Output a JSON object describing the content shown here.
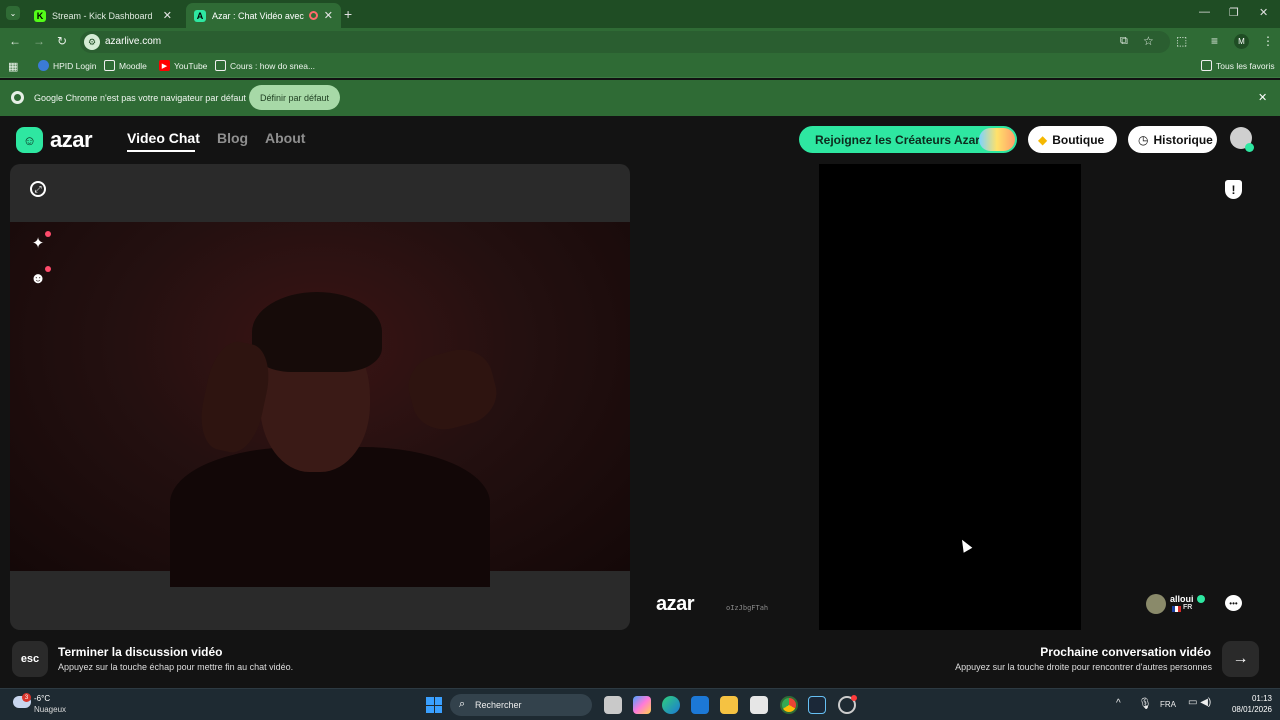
{
  "browser": {
    "tabs": [
      {
        "title": "Stream - Kick Dashboard",
        "favicon": "K"
      },
      {
        "title": "Azar : Chat Vidéo avec de n",
        "favicon": "A"
      }
    ],
    "url": "azarlive.com",
    "bookmarks": [
      {
        "label": "HPID Login"
      },
      {
        "label": "Moodle"
      },
      {
        "label": "YouTube"
      },
      {
        "label": "Cours : how do snea..."
      }
    ],
    "all_bookmarks": "Tous les favoris",
    "infobar": {
      "message": "Google Chrome n'est pas votre navigateur par défaut",
      "button": "Définir par défaut"
    }
  },
  "site": {
    "logo": "azar",
    "nav": {
      "video_chat": "Video Chat",
      "blog": "Blog",
      "about": "About"
    },
    "creators_button": "Rejoignez les Créateurs Azar",
    "shop_button": "Boutique",
    "history_button": "Historique"
  },
  "call": {
    "watermark": "azar",
    "watermark_id": "oIzJbgFTah",
    "peer": {
      "name": "alloui",
      "country": "FR"
    }
  },
  "footer": {
    "end": {
      "key": "esc",
      "title": "Terminer la discussion vidéo",
      "subtitle": "Appuyez sur la touche échap pour mettre fin au chat vidéo."
    },
    "next": {
      "key": "→",
      "title": "Prochaine conversation vidéo",
      "subtitle": "Appuyez sur la touche droite pour rencontrer d'autres personnes"
    }
  },
  "taskbar": {
    "weather": {
      "temp": "-6°C",
      "condition": "Nuageux",
      "badge": "3"
    },
    "search_placeholder": "Rechercher",
    "language": "FRA",
    "time": "01:13",
    "date": "08/01/2026"
  },
  "colors": {
    "accent": "#2ee7a1",
    "chrome_green": "#2f6b35"
  }
}
